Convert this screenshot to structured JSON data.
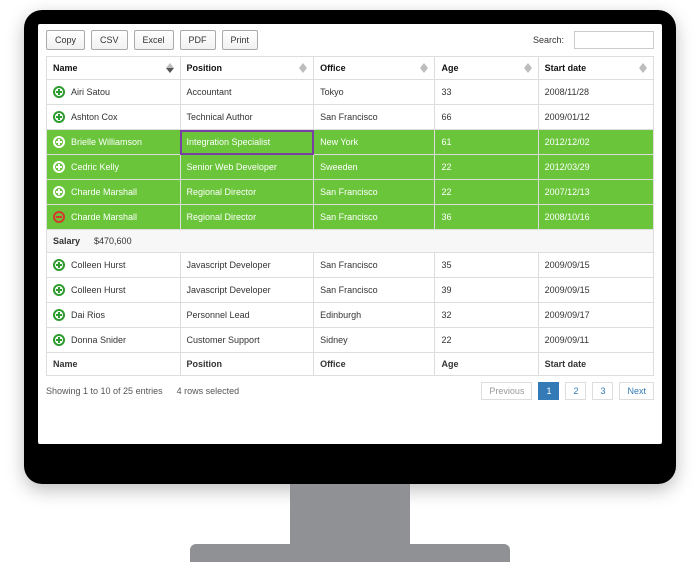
{
  "toolbar": {
    "copy": "Copy",
    "csv": "CSV",
    "excel": "Excel",
    "pdf": "PDF",
    "print": "Print"
  },
  "search": {
    "label": "Search:",
    "value": ""
  },
  "columns": {
    "name": "Name",
    "position": "Position",
    "office": "Office",
    "age": "Age",
    "start_date": "Start date"
  },
  "rows": [
    {
      "selected": false,
      "expanded": false,
      "name": "Airi Satou",
      "position": "Accountant",
      "office": "Tokyo",
      "age": "33",
      "start": "2008/11/28"
    },
    {
      "selected": false,
      "expanded": false,
      "name": "Ashton Cox",
      "position": "Technical Author",
      "office": "San Francisco",
      "age": "66",
      "start": "2009/01/12"
    },
    {
      "selected": true,
      "expanded": false,
      "highlight_position": true,
      "name": "Brielle Williamson",
      "position": "Integration Specialist",
      "office": "New York",
      "age": "61",
      "start": "2012/12/02"
    },
    {
      "selected": true,
      "expanded": false,
      "name": "Cedric Kelly",
      "position": "Senior Web Developer",
      "office": "Sweeden",
      "age": "22",
      "start": "2012/03/29"
    },
    {
      "selected": true,
      "expanded": false,
      "name": "Charde Marshall",
      "position": "Regional Director",
      "office": "San Francisco",
      "age": "22",
      "start": "2007/12/13"
    },
    {
      "selected": true,
      "expanded": true,
      "name": "Charde Marshall",
      "position": "Regional Director",
      "office": "San Francisco",
      "age": "36",
      "start": "2008/10/16"
    },
    {
      "selected": false,
      "expanded": false,
      "name": "Colleen Hurst",
      "position": "Javascript Developer",
      "office": "San Francisco",
      "age": "35",
      "start": "2009/09/15"
    },
    {
      "selected": false,
      "expanded": false,
      "name": "Colleen Hurst",
      "position": "Javascript Developer",
      "office": "San Francisco",
      "age": "39",
      "start": "2009/09/15"
    },
    {
      "selected": false,
      "expanded": false,
      "name": "Dai Rios",
      "position": "Personnel Lead",
      "office": "Edinburgh",
      "age": "32",
      "start": "2009/09/17"
    },
    {
      "selected": false,
      "expanded": false,
      "name": "Donna Snider",
      "position": "Customer Support",
      "office": "Sidney",
      "age": "22",
      "start": "2009/09/11"
    }
  ],
  "detail": {
    "label": "Salary",
    "value": "$470,600"
  },
  "footer_info": "Showing 1 to 10 of 25 entries",
  "footer_sel": "4 rows selected",
  "pager": {
    "prev": "Previous",
    "pages": [
      "1",
      "2",
      "3"
    ],
    "current": "1",
    "next": "Next"
  }
}
